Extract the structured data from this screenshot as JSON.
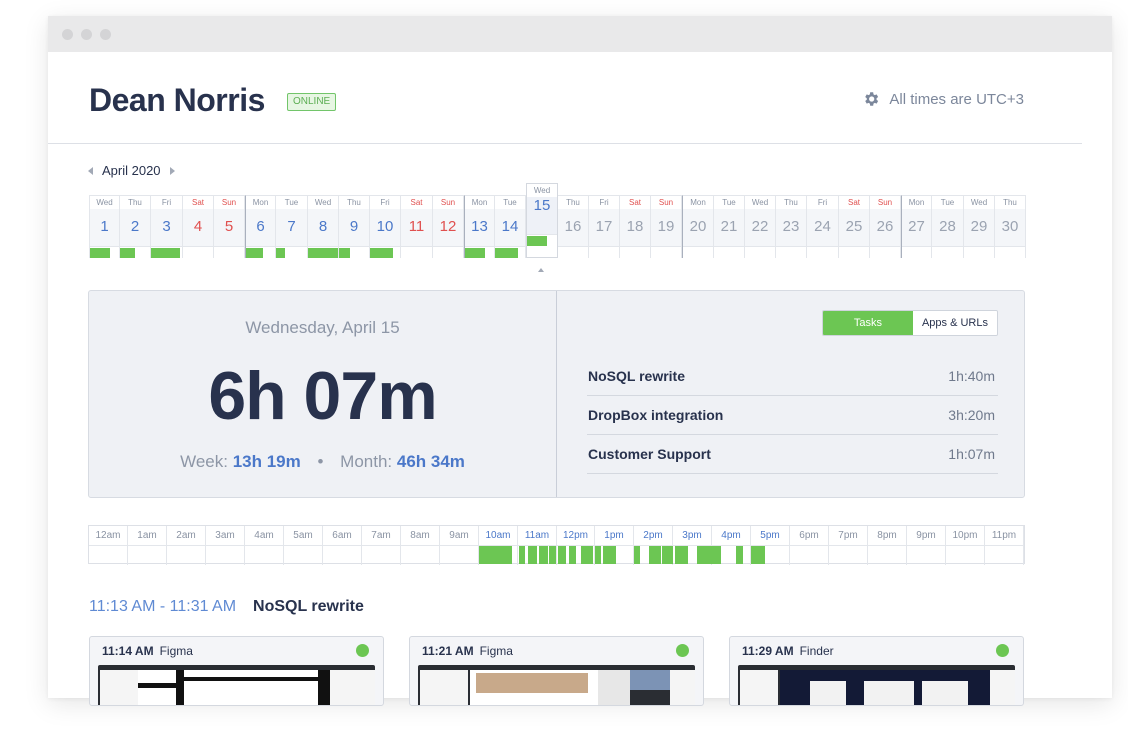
{
  "window": {
    "controls": [
      "close",
      "minimize",
      "maximize"
    ]
  },
  "header": {
    "user_name": "Dean Norris",
    "status": "ONLINE",
    "timezone_note": "All times are UTC+3",
    "settings_icon": "gear-icon"
  },
  "calendar": {
    "month_label": "April 2020",
    "selected_day": 15,
    "days": [
      {
        "dow": "Wed",
        "num": "1",
        "weekend": false,
        "future": false,
        "activity": 0.7
      },
      {
        "dow": "Thu",
        "num": "2",
        "weekend": false,
        "future": false,
        "activity": 0.5
      },
      {
        "dow": "Fri",
        "num": "3",
        "weekend": false,
        "future": false,
        "activity": 0.95
      },
      {
        "dow": "Sat",
        "num": "4",
        "weekend": true,
        "future": false,
        "activity": 0
      },
      {
        "dow": "Sun",
        "num": "5",
        "weekend": true,
        "future": false,
        "activity": 0
      },
      {
        "dow": "Mon",
        "num": "6",
        "weekend": false,
        "future": false,
        "activity": 0.6
      },
      {
        "dow": "Tue",
        "num": "7",
        "weekend": false,
        "future": false,
        "activity": 0.3
      },
      {
        "dow": "Wed",
        "num": "8",
        "weekend": false,
        "future": false,
        "activity": 1.0
      },
      {
        "dow": "Thu",
        "num": "9",
        "weekend": false,
        "future": false,
        "activity": 0.35
      },
      {
        "dow": "Fri",
        "num": "10",
        "weekend": false,
        "future": false,
        "activity": 0.75
      },
      {
        "dow": "Sat",
        "num": "11",
        "weekend": true,
        "future": false,
        "activity": 0
      },
      {
        "dow": "Sun",
        "num": "12",
        "weekend": true,
        "future": false,
        "activity": 0
      },
      {
        "dow": "Mon",
        "num": "13",
        "weekend": false,
        "future": false,
        "activity": 0.7
      },
      {
        "dow": "Tue",
        "num": "14",
        "weekend": false,
        "future": false,
        "activity": 0.75
      },
      {
        "dow": "Wed",
        "num": "15",
        "weekend": false,
        "future": false,
        "activity": 0.65
      },
      {
        "dow": "Thu",
        "num": "16",
        "weekend": false,
        "future": true,
        "activity": 0
      },
      {
        "dow": "Fri",
        "num": "17",
        "weekend": false,
        "future": true,
        "activity": 0
      },
      {
        "dow": "Sat",
        "num": "18",
        "weekend": true,
        "future": true,
        "activity": 0
      },
      {
        "dow": "Sun",
        "num": "19",
        "weekend": true,
        "future": true,
        "activity": 0
      },
      {
        "dow": "Mon",
        "num": "20",
        "weekend": false,
        "future": true,
        "activity": 0
      },
      {
        "dow": "Tue",
        "num": "21",
        "weekend": false,
        "future": true,
        "activity": 0
      },
      {
        "dow": "Wed",
        "num": "22",
        "weekend": false,
        "future": true,
        "activity": 0
      },
      {
        "dow": "Thu",
        "num": "23",
        "weekend": false,
        "future": true,
        "activity": 0
      },
      {
        "dow": "Fri",
        "num": "24",
        "weekend": false,
        "future": true,
        "activity": 0
      },
      {
        "dow": "Sat",
        "num": "25",
        "weekend": true,
        "future": true,
        "activity": 0
      },
      {
        "dow": "Sun",
        "num": "26",
        "weekend": true,
        "future": true,
        "activity": 0
      },
      {
        "dow": "Mon",
        "num": "27",
        "weekend": false,
        "future": true,
        "activity": 0
      },
      {
        "dow": "Tue",
        "num": "28",
        "weekend": false,
        "future": true,
        "activity": 0
      },
      {
        "dow": "Wed",
        "num": "29",
        "weekend": false,
        "future": true,
        "activity": 0
      },
      {
        "dow": "Thu",
        "num": "30",
        "weekend": false,
        "future": true,
        "activity": 0
      }
    ]
  },
  "summary": {
    "day_title": "Wednesday, April 15",
    "day_total": "6h 07m",
    "week_label": "Week:",
    "week_value": "13h 19m",
    "separator": "•",
    "month_label": "Month:",
    "month_value": "46h 34m",
    "tabs": [
      {
        "label": "Tasks",
        "active": true
      },
      {
        "label": "Apps & URLs",
        "active": false
      }
    ],
    "tasks": [
      {
        "name": "NoSQL rewrite",
        "time": "1h:40m"
      },
      {
        "name": "DropBox integration",
        "time": "3h:20m"
      },
      {
        "name": "Customer Support",
        "time": "1h:07m"
      }
    ]
  },
  "timeline": {
    "hours": [
      {
        "label": "12am",
        "active": false
      },
      {
        "label": "1am",
        "active": false
      },
      {
        "label": "2am",
        "active": false
      },
      {
        "label": "3am",
        "active": false
      },
      {
        "label": "4am",
        "active": false
      },
      {
        "label": "5am",
        "active": false
      },
      {
        "label": "6am",
        "active": false
      },
      {
        "label": "7am",
        "active": false
      },
      {
        "label": "8am",
        "active": false
      },
      {
        "label": "9am",
        "active": false
      },
      {
        "label": "10am",
        "active": true
      },
      {
        "label": "11am",
        "active": true
      },
      {
        "label": "12pm",
        "active": true
      },
      {
        "label": "1pm",
        "active": true
      },
      {
        "label": "2pm",
        "active": true
      },
      {
        "label": "3pm",
        "active": true
      },
      {
        "label": "4pm",
        "active": true
      },
      {
        "label": "5pm",
        "active": true
      },
      {
        "label": "6pm",
        "active": false
      },
      {
        "label": "7pm",
        "active": false
      },
      {
        "label": "8pm",
        "active": false
      },
      {
        "label": "9pm",
        "active": false
      },
      {
        "label": "10pm",
        "active": false
      },
      {
        "label": "11pm",
        "active": false
      }
    ],
    "segments_hours": [
      [
        10.0,
        10.85
      ],
      [
        11.05,
        11.2
      ],
      [
        11.28,
        11.5
      ],
      [
        11.55,
        11.78
      ],
      [
        11.82,
        12.0
      ],
      [
        12.05,
        12.25
      ],
      [
        12.32,
        12.5
      ],
      [
        12.62,
        12.95
      ],
      [
        13.0,
        13.15
      ],
      [
        13.2,
        13.52
      ],
      [
        14.0,
        14.15
      ],
      [
        14.38,
        14.68
      ],
      [
        14.72,
        15.0
      ],
      [
        15.05,
        15.38
      ],
      [
        15.6,
        16.22
      ],
      [
        16.62,
        16.78
      ],
      [
        16.98,
        17.35
      ]
    ]
  },
  "session": {
    "range": "11:13 AM - 11:31 AM",
    "task": "NoSQL rewrite"
  },
  "screenshots": [
    {
      "time": "11:14 AM",
      "app": "Figma"
    },
    {
      "time": "11:21 AM",
      "app": "Figma"
    },
    {
      "time": "11:29 AM",
      "app": "Finder"
    }
  ],
  "colors": {
    "accent_green": "#6cc653",
    "link_blue": "#4b78c9",
    "weekend_red": "#e0504f",
    "text_dark": "#28324d"
  }
}
